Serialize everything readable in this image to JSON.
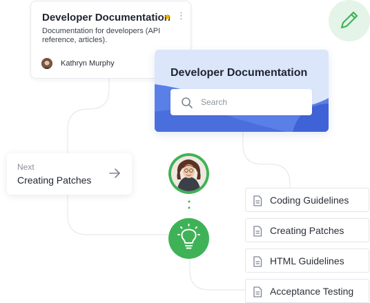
{
  "doc_card": {
    "title": "Developer Documentation",
    "description": "Documentation for developers (API reference, articles).",
    "author": "Kathryn Murphy"
  },
  "hero": {
    "title": "Developer Documentation",
    "search_placeholder": "Search"
  },
  "next": {
    "label": "Next",
    "title": "Creating Patches"
  },
  "guides": [
    {
      "label": "Coding Guidelines"
    },
    {
      "label": "Creating Patches"
    },
    {
      "label": "HTML Guidelines"
    },
    {
      "label": "Acceptance Testing"
    }
  ],
  "colors": {
    "accent_green": "#3fb257",
    "hero_blue": "#4d74e2",
    "hero_light": "#dbe6fb",
    "star": "#f5b40c"
  },
  "icons": [
    "star-icon",
    "kebab-menu-icon",
    "pencil-icon",
    "search-icon",
    "arrow-right-icon",
    "lightbulb-icon",
    "document-icon"
  ]
}
